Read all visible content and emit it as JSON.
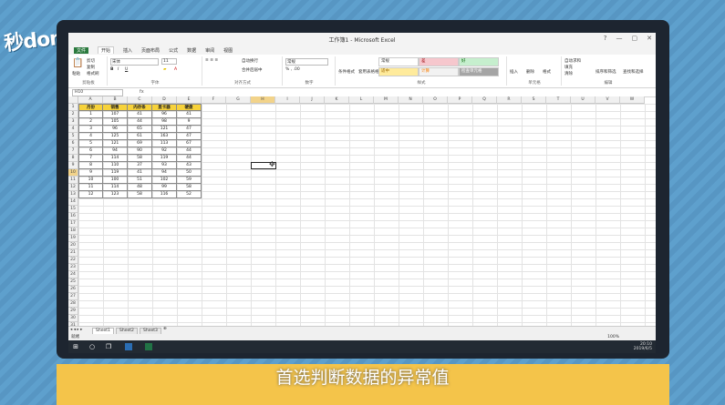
{
  "watermark": {
    "logo_text": "秒dong视频"
  },
  "window": {
    "title": "工作簿1 - Microsoft Excel",
    "controls": [
      "?",
      "—",
      "▢",
      "✕"
    ]
  },
  "ribbon_tabs": [
    "文件",
    "开始",
    "插入",
    "页面布局",
    "公式",
    "数据",
    "审阅",
    "视图"
  ],
  "ribbon": {
    "clipboard": {
      "paste": "粘贴",
      "cut": "剪切",
      "copy": "复制",
      "format_painter": "格式刷",
      "group": "剪贴板"
    },
    "font": {
      "name": "宋体",
      "size": "11",
      "group": "字体"
    },
    "alignment": {
      "wrap": "自动换行",
      "merge": "合并后居中",
      "group": "对齐方式"
    },
    "number": {
      "format": "常规",
      "group": "数字"
    },
    "styles": {
      "conditional": "条件格式",
      "table": "套用表格格式",
      "normal": "常规",
      "bad": "差",
      "good": "好",
      "neutral": "适中",
      "calc": "计算",
      "check": "检查单元格",
      "group": "样式"
    },
    "cells": {
      "insert": "插入",
      "delete": "删除",
      "format": "格式",
      "group": "单元格"
    },
    "editing": {
      "autosum": "自动求和",
      "fill": "填充",
      "clear": "清除",
      "sort": "排序和筛选",
      "find": "查找和选择",
      "group": "编辑"
    }
  },
  "formula_bar": {
    "name_box": "H10",
    "fx": "fx"
  },
  "columns": [
    "A",
    "B",
    "C",
    "D",
    "E",
    "F",
    "G",
    "H",
    "I",
    "J",
    "K",
    "L",
    "M",
    "N",
    "O",
    "P",
    "Q",
    "R",
    "S",
    "T",
    "U",
    "V",
    "W"
  ],
  "selected_column": "H",
  "selected_row": "10",
  "table": {
    "headers": [
      "月份",
      "销售",
      "内存条",
      "显卡器",
      "硬盘"
    ],
    "rows": [
      [
        "1",
        "107",
        "41",
        "96",
        "41"
      ],
      [
        "2",
        "105",
        "44",
        "98",
        "9"
      ],
      [
        "3",
        "96",
        "65",
        "121",
        "47"
      ],
      [
        "4",
        "125",
        "61",
        "163",
        "47"
      ],
      [
        "5",
        "121",
        "69",
        "113",
        "67"
      ],
      [
        "6",
        "94",
        "90",
        "92",
        "44"
      ],
      [
        "7",
        "114",
        "58",
        "119",
        "44"
      ],
      [
        "8",
        "110",
        "37",
        "93",
        "43"
      ],
      [
        "9",
        "119",
        "41",
        "94",
        "50"
      ],
      [
        "10",
        "100",
        "51",
        "102",
        "59"
      ],
      [
        "11",
        "114",
        "48",
        "99",
        "58"
      ],
      [
        "12",
        "123",
        "58",
        "116",
        "52"
      ]
    ]
  },
  "sheets": [
    "Sheet1",
    "Sheet2",
    "Sheet3"
  ],
  "status": {
    "ready": "就绪",
    "zoom": "100%"
  },
  "tray": {
    "time": "20:10",
    "date": "2019/6/5"
  },
  "caption": "首选判断数据的异常值"
}
